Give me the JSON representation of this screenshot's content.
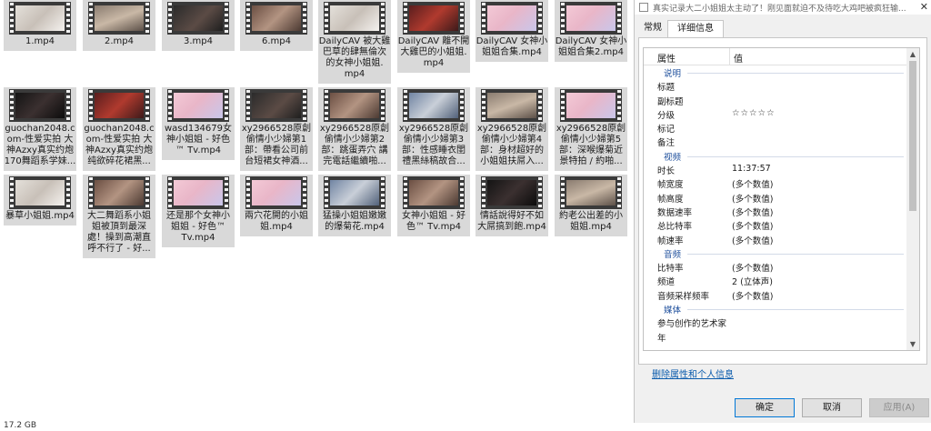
{
  "files": [
    {
      "name": "1.mp4",
      "thumb": "ph-bright"
    },
    {
      "name": "2.mp4",
      "thumb": "ph-room"
    },
    {
      "name": "3.mp4",
      "thumb": "ph-dark"
    },
    {
      "name": "6.mp4",
      "thumb": "ph-warm"
    },
    {
      "name": "DailyCAV 被大雞\n巴草的肆無倫次\n的女神小姐姐.\nmp4",
      "thumb": "ph-bright"
    },
    {
      "name": "DailyCAV 離不開\n大雞巴的小姐姐.\nmp4",
      "thumb": "ph-red"
    },
    {
      "name": "DailyCAV 女神小\n姐姐合集.mp4",
      "thumb": "ph-pink"
    },
    {
      "name": "DailyCAV 女神小\n姐姐合集2.mp4",
      "thumb": "ph-pink"
    },
    {
      "name": "guochan2048.c\nom-性爱实拍 大\n神Azxy真实约炮\n170舞蹈系学妹...",
      "thumb": "ph-night"
    },
    {
      "name": "guochan2048.c\nom-性爱实拍 大\n神Azxy真实约炮\n纯欲碎花裙黑...",
      "thumb": "ph-red"
    },
    {
      "name": "wasd134679女\n神小姐姐 - 好色\n™ Tv.mp4",
      "thumb": "ph-pink"
    },
    {
      "name": "xy2966528原創\n偷情小少婦第1\n部：帶看公司前\n台短裙女神酒...",
      "thumb": "ph-dark"
    },
    {
      "name": "xy2966528原創\n偷情小少婦第2\n部：跳蛋弄穴 講\n完電話繼續啪...",
      "thumb": "ph-warm"
    },
    {
      "name": "xy2966528原創\n偷情小少婦第3\n部：性感睡衣閨\n禮黑絲稿故合...",
      "thumb": "ph-blue"
    },
    {
      "name": "xy2966528原創\n偷情小少婦第4\n部：身材超好的\n小姐姐扶屌入...",
      "thumb": "ph-room"
    },
    {
      "name": "xy2966528原創\n偷情小少婦第5\n部：深喉爆菊近\n景特拍 / 約啪...",
      "thumb": "ph-pink"
    },
    {
      "name": "暴草小姐姐.mp4",
      "thumb": "ph-bright"
    },
    {
      "name": "大二舞蹈系小姐\n姐被頂到最深\n處！操到高潮直\n呼不行了 - 好...",
      "thumb": "ph-warm"
    },
    {
      "name": "还是那个女神小\n姐姐 - 好色™\nTv.mp4",
      "thumb": "ph-pink"
    },
    {
      "name": "兩穴花開的小姐\n姐.mp4",
      "thumb": "ph-pink"
    },
    {
      "name": "猛操小姐姐嫩嫩\n的爆菊花.mp4",
      "thumb": "ph-blue"
    },
    {
      "name": "女神小姐姐 - 好\n色™ Tv.mp4",
      "thumb": "ph-warm"
    },
    {
      "name": "情話說得好不如\n大屌搞到飽.mp4",
      "thumb": "ph-night"
    },
    {
      "name": "約老公出差的小\n姐姐.mp4",
      "thumb": "ph-room"
    }
  ],
  "statusbar": {
    "size": "17.2 GB"
  },
  "dialog": {
    "title": "真实记录大二小姐姐太主动了！刚见面就迫不及待吃大鸡吧被疯狂输...",
    "close": "✕",
    "tabs": [
      {
        "label": "常规"
      },
      {
        "label": "详细信息"
      }
    ],
    "columns": {
      "property": "属性",
      "value": "值"
    },
    "rows": [
      {
        "type": "section",
        "label": "说明"
      },
      {
        "type": "row",
        "key": "标题",
        "value": ""
      },
      {
        "type": "row",
        "key": "副标题",
        "value": ""
      },
      {
        "type": "row",
        "key": "分级",
        "value": "☆☆☆☆☆",
        "stars": true
      },
      {
        "type": "row",
        "key": "标记",
        "value": ""
      },
      {
        "type": "row",
        "key": "备注",
        "value": ""
      },
      {
        "type": "section",
        "label": "视频"
      },
      {
        "type": "row",
        "key": "时长",
        "value": "11:37:57"
      },
      {
        "type": "row",
        "key": "帧宽度",
        "value": "(多个数值)"
      },
      {
        "type": "row",
        "key": "帧高度",
        "value": "(多个数值)"
      },
      {
        "type": "row",
        "key": "数据速率",
        "value": "(多个数值)"
      },
      {
        "type": "row",
        "key": "总比特率",
        "value": "(多个数值)"
      },
      {
        "type": "row",
        "key": "帧速率",
        "value": "(多个数值)"
      },
      {
        "type": "section",
        "label": "音频"
      },
      {
        "type": "row",
        "key": "比特率",
        "value": "(多个数值)"
      },
      {
        "type": "row",
        "key": "频道",
        "value": "2 (立体声)"
      },
      {
        "type": "row",
        "key": "音频采样频率",
        "value": "(多个数值)"
      },
      {
        "type": "section",
        "label": "媒体"
      },
      {
        "type": "row",
        "key": "参与创作的艺术家",
        "value": ""
      },
      {
        "type": "row",
        "key": "年",
        "value": ""
      }
    ],
    "remove_link": "删除属性和个人信息",
    "buttons": {
      "ok": "确定",
      "cancel": "取消",
      "apply": "应用(A)"
    }
  }
}
